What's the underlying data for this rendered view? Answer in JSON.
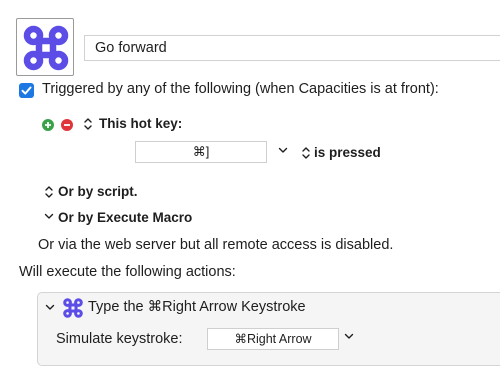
{
  "macro": {
    "icon": "command-icon",
    "name": "Go forward"
  },
  "trigger": {
    "checked": true,
    "label": "Triggered by any of the following (when Capacities is at front):",
    "hotkey": {
      "label": "This hot key:",
      "value": "⌘]",
      "condition": "is pressed"
    },
    "by_script": "Or by script.",
    "by_execute_macro": "Or by Execute Macro",
    "web_server": "Or via the web server but all remote access is disabled."
  },
  "actions": {
    "header": "Will execute the following actions:",
    "items": [
      {
        "title": "Type the ⌘Right Arrow Keystroke",
        "simulate_label": "Simulate keystroke:",
        "keystroke": "⌘Right Arrow"
      }
    ]
  },
  "colors": {
    "icon_purple": "#5b4de6",
    "checkbox_blue": "#1e78e3",
    "add_green": "#3aa34a",
    "remove_red": "#e0343b"
  }
}
